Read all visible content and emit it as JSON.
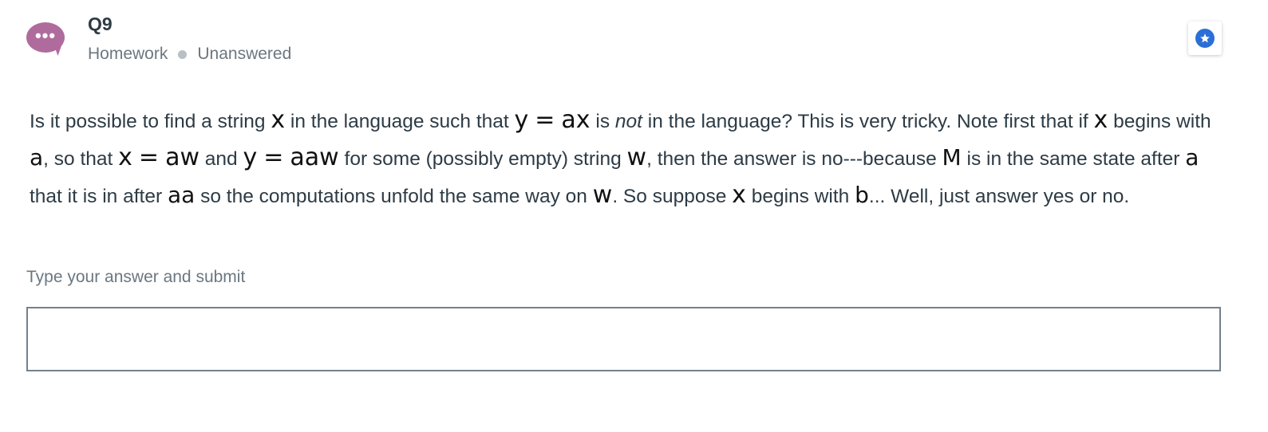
{
  "header": {
    "avatar_icon": "speech-bubble-dots-icon",
    "avatar_color": "#b06b9d",
    "title": "Q9",
    "category": "Homework",
    "status": "Unanswered",
    "star_icon": "star-icon",
    "star_color": "#2b6fd6"
  },
  "question": {
    "t1": "Is it possible to find a string",
    "m_x1": "x",
    "t2": "in the language such that",
    "m_y1": "y",
    "m_eq1": "=",
    "m_ax": "ax",
    "t3": "is",
    "em_not": "not",
    "t4": "in the language? This is very tricky. Note first that if",
    "m_x2": "x",
    "t5": "begins with",
    "m_a1": "a",
    "t6": ", so that",
    "m_x3": "x",
    "m_eq2": "=",
    "m_aw": "aw",
    "t7": "and",
    "m_y2": "y",
    "m_eq3": "=",
    "m_aaw": "aaw",
    "t8": "for some (possibly empty) string",
    "m_w1": "w",
    "t9": ", then the answer is no---because",
    "m_M": "M",
    "t10": "is in the same state after",
    "m_a2": "a",
    "t11": "that it is in after",
    "m_aa": "aa",
    "t12": "so the computations unfold the same way on",
    "m_w2": "w",
    "t13": ". So suppose",
    "m_x4": "x",
    "t14": "begins with",
    "m_b": "b",
    "t15": "... Well, just answer yes or no."
  },
  "answer": {
    "hint": "Type your answer and submit",
    "value": ""
  }
}
